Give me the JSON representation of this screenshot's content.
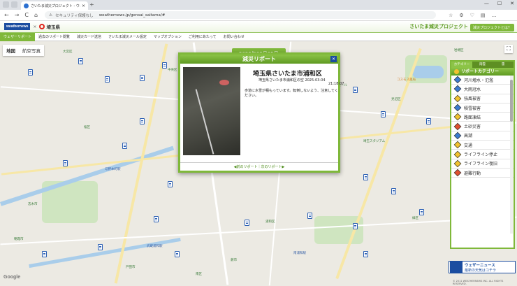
{
  "browser": {
    "tab_title": "さいたま減災プロジェクト - ウェザーニュ",
    "tab_close": "×",
    "new_tab": "+",
    "security": "セキュリティ保護なし",
    "url": "weathernews.jp/gensai_saitama/#",
    "nav": {
      "back": "←",
      "forward": "→",
      "reload": "C",
      "home": "⌂",
      "info": "⚠"
    },
    "window_controls": {
      "minimize": "—",
      "maximize": "☐",
      "close": "✕"
    },
    "toolbar_icons": {
      "star": "☆",
      "extensions": "⚙",
      "favorites": "♡",
      "collections": "▤",
      "more": "…"
    }
  },
  "site": {
    "logo": "weathernews",
    "separator": "×",
    "pref_logo": "埼玉県",
    "brand": "さいたま減災プロジェクト",
    "brand_button": "減災プロジェクトとは？"
  },
  "menu": [
    "ウェザーリポート",
    "過去のリポート閲覧",
    "減災カード送信",
    "さいたま減災メール設定",
    "マップオプション",
    "ご利用にあたって",
    "お問い合わせ"
  ],
  "map": {
    "type_map": "地図",
    "type_satellite": "航空写真",
    "date_badge": "2025年03月05日",
    "fullscreen": "⛶",
    "google": "Google",
    "labels": [
      "大宮区",
      "中央区",
      "浦和区",
      "南区",
      "緑区",
      "桜区",
      "見沼区",
      "岩槻区",
      "与野本町駅",
      "北浦和駅",
      "南浦和駅",
      "武蔵浦和駅",
      "さいたま新都心駅",
      "コスモス薬局",
      "埼玉スタジアム",
      "イオンモール",
      "朝霞市",
      "志木市",
      "戸田市",
      "蕨市"
    ]
  },
  "popup": {
    "title": "減災リポート",
    "close": "✕",
    "location": "埼玉県さいたま市浦和区",
    "subtitle": "埼玉県さいたま市浦和区の空 2025-03-04",
    "time": "21:18:07",
    "message": "歩道に水雪が積もっています。転倒しないよう、注意してください。",
    "nav": "◀前のリポート｜次のリポート▶"
  },
  "category": {
    "tabs": [
      "カテゴリー",
      "雨雲",
      "雷"
    ],
    "header": "リポートカテゴリー",
    "items": [
      {
        "label": "河川増水・氾濫",
        "color": "blue"
      },
      {
        "label": "大雨冠水",
        "color": "blue"
      },
      {
        "label": "強風被害",
        "color": "yellow"
      },
      {
        "label": "積雪被害",
        "color": "blue"
      },
      {
        "label": "路面凍結",
        "color": "yellow"
      },
      {
        "label": "土砂災害",
        "color": "red"
      },
      {
        "label": "高潮",
        "color": "blue"
      },
      {
        "label": "交通",
        "color": "yellow"
      },
      {
        "label": "ライフライン停止",
        "color": "yellow"
      },
      {
        "label": "ライフライン復旧",
        "color": "yellow"
      },
      {
        "label": "避難行動",
        "color": "red"
      }
    ]
  },
  "banner": {
    "title": "ウェザーニュース",
    "subtitle": "最新の天気はコチラ"
  },
  "copyright": "© 2011 WEATHERNEWS INC. ALL RIGHTS RESERVED."
}
